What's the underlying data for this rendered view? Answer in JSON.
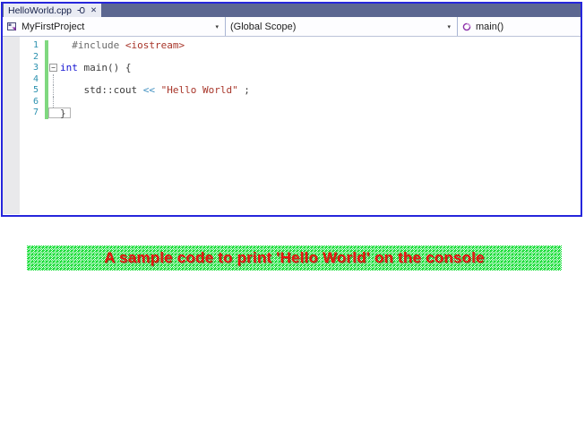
{
  "editor": {
    "tab": {
      "title": "HelloWorld.cpp",
      "close_glyph": "✕"
    },
    "navbar": {
      "dropdown_glyph": "▾",
      "project": {
        "value": "MyFirstProject"
      },
      "scope": {
        "value": "(Global Scope)"
      },
      "member": {
        "value": "main()"
      }
    },
    "code": {
      "collapse_glyph": "−",
      "lines": [
        {
          "num": "1",
          "tokens": {
            "t0": "  #include ",
            "t1": "<iostream>"
          }
        },
        {
          "num": "2"
        },
        {
          "num": "3",
          "tokens": {
            "t0": "int",
            "t1": " main() {"
          }
        },
        {
          "num": "4"
        },
        {
          "num": "5",
          "tokens": {
            "t0": "    std::cout ",
            "t1": "<< ",
            "t2": "\"Hello World\"",
            "t3": " ;"
          }
        },
        {
          "num": "6"
        },
        {
          "num": "7",
          "tokens": {
            "t0": "}"
          }
        }
      ]
    }
  },
  "banner": {
    "text": "A sample code to print 'Hello World' on the console"
  },
  "colors": {
    "window_border": "#2626dc",
    "tabstrip_bg": "#5c6791",
    "active_tab_bg": "#e9ebf3",
    "line_number": "#2b91af",
    "change_bar_green": "#7fd87f",
    "keyword_blue": "#1414d2",
    "string_red": "#a8362a",
    "preprocessor_gray": "#6a6a6a",
    "operator_blue": "#3f8fc0",
    "banner_green": "#00dc28",
    "banner_text_red": "#e8150f"
  }
}
